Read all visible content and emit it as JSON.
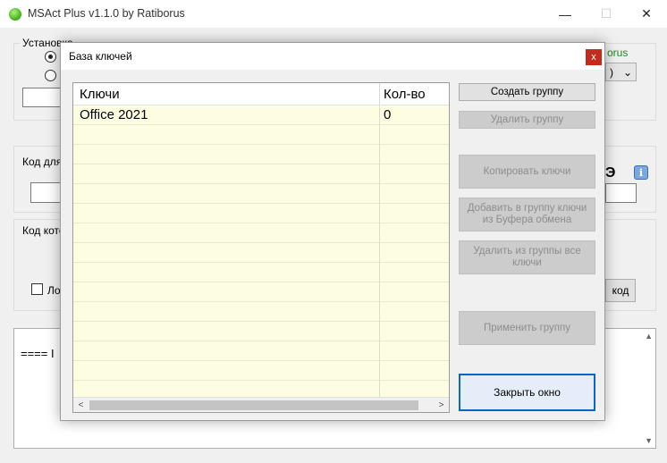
{
  "app": {
    "title": "MSAct Plus v1.1.0 by Ratiborus",
    "minimize_glyph": "—",
    "maximize_glyph": "☐",
    "close_glyph": "✕"
  },
  "background": {
    "group1_label_visible": "Установка",
    "group1_label_hidden": "Установка и проверка ключа",
    "ratiborus_fragment": "orus",
    "combo_fragment": ")",
    "combo_arrow": "⌄",
    "group2_label": "Код для",
    "bold_fragment": "Э",
    "info_icon_glyph": "i",
    "group3_label": "Код кото",
    "checkbox_label": "Ло",
    "code_button_fragment": "код",
    "log_text": "==== I"
  },
  "dialog": {
    "title": "База ключей",
    "close_glyph": "x",
    "grid": {
      "columns": [
        "Ключи",
        "Кол-во"
      ],
      "rows": [
        {
          "key": "Office 2021",
          "count": "0"
        }
      ],
      "scroll_left": "<",
      "scroll_right": ">"
    },
    "buttons": {
      "create_group": "Создать группу",
      "delete_group": "Удалить группу",
      "copy_keys": "Копировать ключи",
      "add_from_clipboard": "Добавить в группу ключи из Буфера обмена",
      "delete_all_keys": "Удалить из группы все ключи",
      "apply_group": "Применить группу",
      "close_window": "Закрыть окно"
    }
  }
}
